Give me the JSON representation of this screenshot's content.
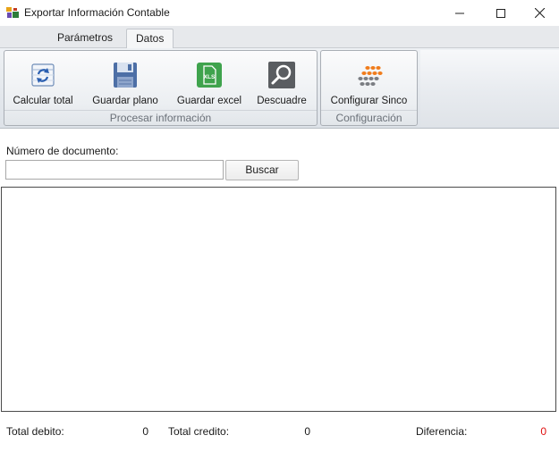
{
  "window": {
    "title": "Exportar Información Contable",
    "icon": "app-icon"
  },
  "tabs": [
    {
      "label": "Parámetros",
      "selected": false
    },
    {
      "label": "Datos",
      "selected": true
    }
  ],
  "ribbon": {
    "groups": [
      {
        "label": "Procesar información",
        "buttons": [
          {
            "label": "Calcular total",
            "icon": "calculator-refresh-icon"
          },
          {
            "label": "Guardar plano",
            "icon": "floppy-disk-icon"
          },
          {
            "label": "Guardar excel",
            "icon": "excel-xls-icon"
          },
          {
            "label": "Descuadre",
            "icon": "magnifier-icon"
          }
        ]
      },
      {
        "label": "Configuración",
        "buttons": [
          {
            "label": "Configurar Sinco",
            "icon": "sinco-dots-icon"
          }
        ]
      }
    ]
  },
  "search": {
    "label": "Número de documento:",
    "value": "",
    "button_label": "Buscar"
  },
  "totals": {
    "debito_label": "Total debito:",
    "debito_value": "0",
    "credito_label": "Total credito:",
    "credito_value": "0",
    "diferencia_label": "Diferencia:",
    "diferencia_value": "0"
  },
  "colors": {
    "diferencia_value": "#e01010",
    "excel_green": "#3fa34d",
    "sinco_orange": "#f07c1c"
  }
}
